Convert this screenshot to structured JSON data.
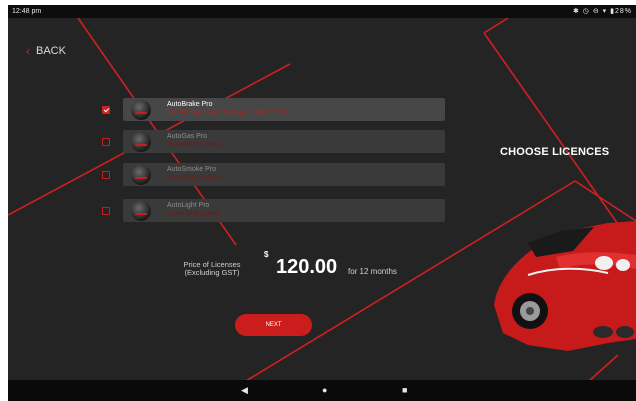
{
  "status_bar": {
    "time": "12:48 pm",
    "icons": [
      "bluetooth-icon",
      "alarm-icon",
      "sync-icon",
      "wifi-icon",
      "battery-icon"
    ],
    "battery_text": "28%"
  },
  "back_label": "BACK",
  "title": "CHOOSE LICENCES",
  "licences": [
    {
      "name": "AutoBrake Pro",
      "status": "Current Expiry Date: Monday, 13 March 2023",
      "checked": true
    },
    {
      "name": "AutoGas Pro",
      "status": "Unavailable Licence",
      "checked": false
    },
    {
      "name": "AutoSmoke Pro",
      "status": "Unavailable Licence",
      "checked": false
    },
    {
      "name": "AutoLight Pro",
      "status": "Unavailable Licence",
      "checked": false
    }
  ],
  "price": {
    "label_line1": "Price of Licenses",
    "label_line2": "(Excluding GST)",
    "currency": "$",
    "amount": "120.00",
    "period": "for 12 months"
  },
  "next_label": "NEXT",
  "nav": {
    "back": "◀",
    "home": "●",
    "recents": "■"
  },
  "colors": {
    "accent": "#cc1d1d",
    "background": "#242424",
    "card": "#3a3a3a"
  }
}
